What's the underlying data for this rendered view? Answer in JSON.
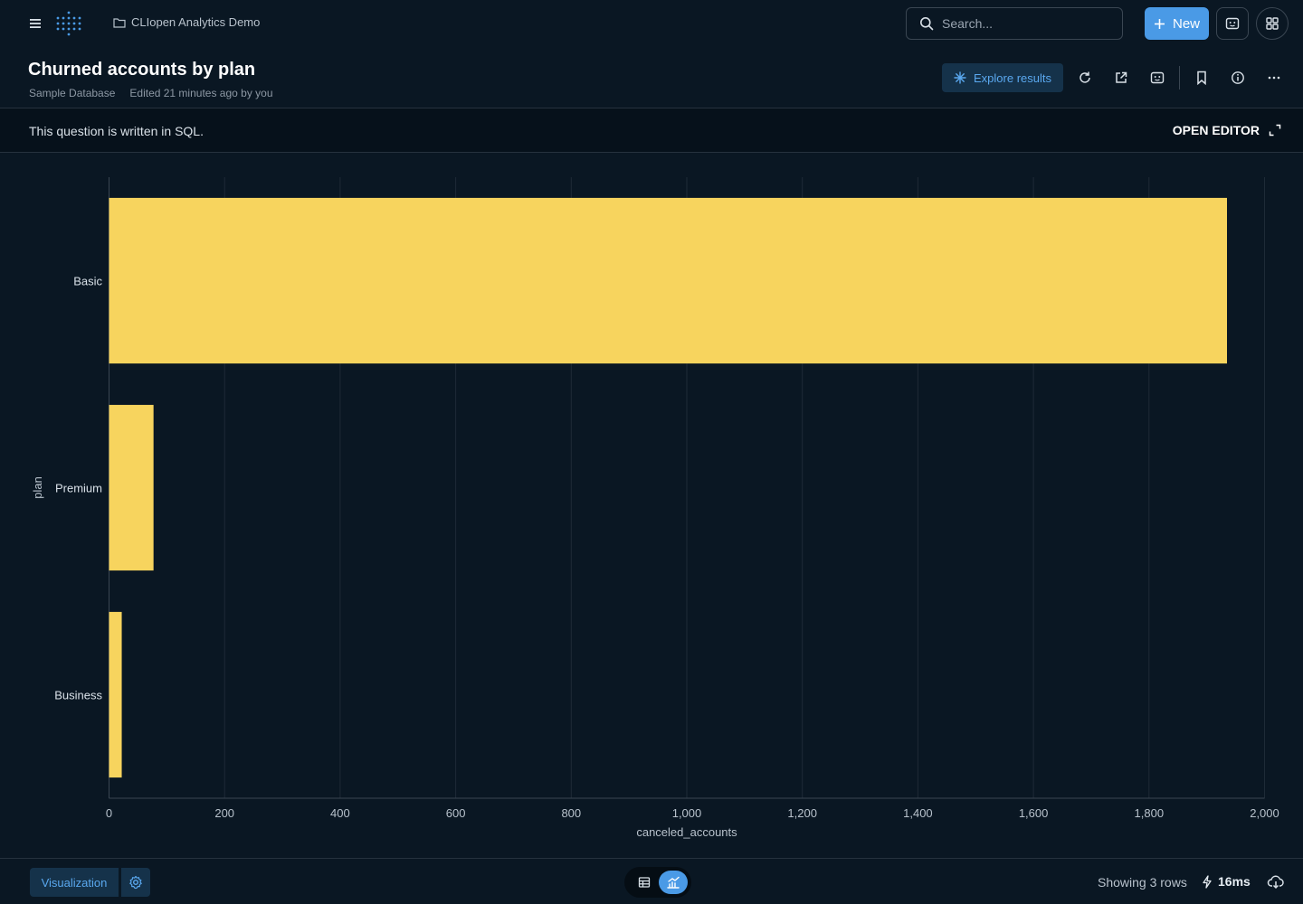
{
  "nav": {
    "collection": "CLIopen Analytics Demo",
    "search_placeholder": "Search...",
    "new_label": "New"
  },
  "question": {
    "title": "Churned accounts by plan",
    "database": "Sample Database",
    "edited": "Edited 21 minutes ago by you",
    "explore_label": "Explore results"
  },
  "sql_strip": {
    "text": "This question is written in SQL.",
    "open_editor_label": "OPEN EDITOR"
  },
  "chart_data": {
    "type": "bar",
    "orientation": "horizontal",
    "categories": [
      "Basic",
      "Premium",
      "Business"
    ],
    "values": [
      1935,
      77,
      22
    ],
    "xlabel": "canceled_accounts",
    "ylabel": "plan",
    "xlim": [
      0,
      2000
    ],
    "x_ticks": [
      0,
      200,
      400,
      600,
      800,
      1000,
      1200,
      1400,
      1600,
      1800,
      2000
    ],
    "x_tick_labels": [
      "0",
      "200",
      "400",
      "600",
      "800",
      "1,000",
      "1,200",
      "1,400",
      "1,600",
      "1,800",
      "2,000"
    ],
    "grid": "vertical",
    "bar_color": "#f7d45e"
  },
  "footer": {
    "visualization_label": "Visualization",
    "rows_text": "Showing 3 rows",
    "timing": "16ms"
  },
  "colors": {
    "background": "#0a1723",
    "accent": "#4a9ae6",
    "bar": "#f7d45e"
  }
}
